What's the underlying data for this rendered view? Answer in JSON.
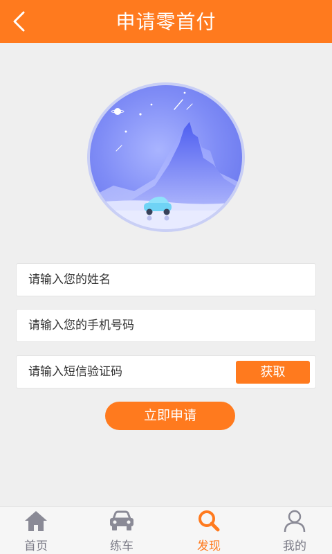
{
  "header": {
    "title": "申请零首付",
    "back_icon": "chevron-left-icon"
  },
  "form": {
    "name_placeholder": "请输入您的姓名",
    "phone_placeholder": "请输入您的手机号码",
    "code_placeholder": "请输入短信验证码",
    "get_code_label": "获取",
    "submit_label": "立即申请"
  },
  "tabbar": {
    "items": [
      {
        "label": "首页",
        "icon": "home-icon",
        "active": false
      },
      {
        "label": "练车",
        "icon": "car-icon",
        "active": false
      },
      {
        "label": "发现",
        "icon": "search-icon",
        "active": true
      },
      {
        "label": "我的",
        "icon": "user-icon",
        "active": false
      }
    ]
  },
  "colors": {
    "accent": "#ff7a1e",
    "background": "#efefef",
    "inactive_tab": "#7a7a86"
  }
}
